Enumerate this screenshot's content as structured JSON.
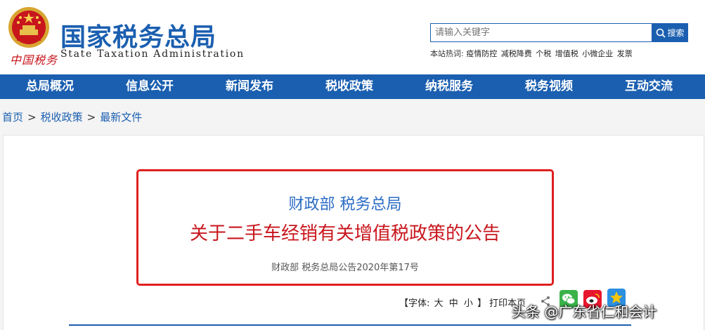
{
  "header": {
    "emblem_text": "中国税务",
    "title": "国家税务总局",
    "subtitle": "State Taxation Administration",
    "search": {
      "placeholder": "请输入关键字",
      "button_label": "搜索"
    },
    "hotwords_label": "本站热词:",
    "hotwords": [
      "疫情防控",
      "减税降费",
      "个税",
      "增值税",
      "小微企业",
      "发票"
    ]
  },
  "nav": {
    "items": [
      "总局概况",
      "信息公开",
      "新闻发布",
      "税收政策",
      "纳税服务",
      "税务视频",
      "互动交流"
    ]
  },
  "breadcrumb": {
    "items": [
      "首页",
      "税收政策",
      "最新文件"
    ],
    "separator": ">"
  },
  "document": {
    "issuer": "财政部 税务总局",
    "title": "关于二手车经销有关增值税政策的公告",
    "number": "财政部 税务总局公告2020年第17号"
  },
  "tools": {
    "font_label": "【字体:",
    "sizes": [
      "大",
      "中",
      "小"
    ],
    "font_end": "】",
    "print_label": "打印本页"
  },
  "watermark": "头条 @广东省仁和会计",
  "colors": {
    "brand_blue": "#1b5fb0",
    "title_red": "#c8161d",
    "frame_red": "#e02020",
    "issuer_blue": "#2b6cc4"
  }
}
